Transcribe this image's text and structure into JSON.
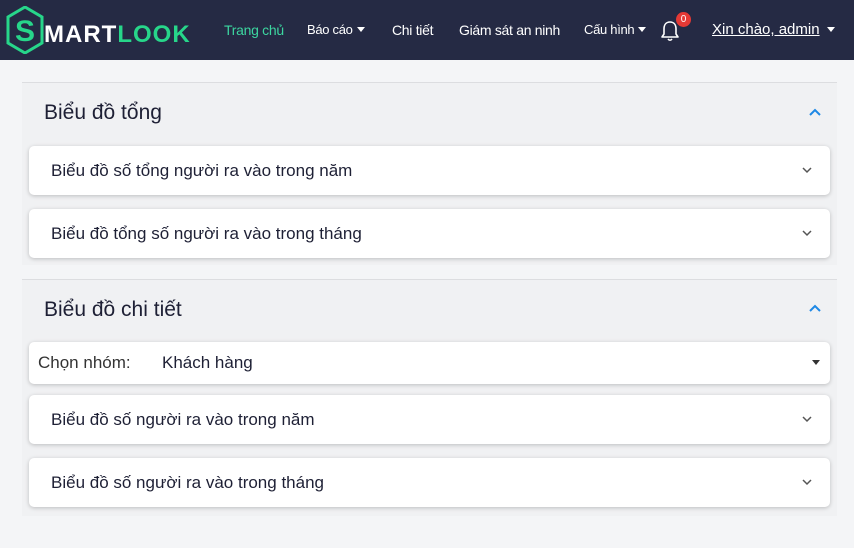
{
  "app": {
    "logo_s": "S",
    "logo_rest_1": "MART",
    "logo_rest_2": "LOOK"
  },
  "nav": {
    "home": "Trang chủ",
    "reports": "Báo cáo",
    "detail": "Chi tiết",
    "security": "Giám sát an ninh",
    "config": "Cấu hình",
    "notification_count": "0",
    "greeting": "Xin chào, admin"
  },
  "colors": {
    "navbar": "#252a44",
    "accent": "#3cd6a0",
    "badge": "#e53935"
  },
  "overview": {
    "title": "Biểu đồ tổng",
    "cards": [
      {
        "label": "Biểu đồ số tổng người ra vào trong năm"
      },
      {
        "label": "Biểu đồ tổng số người ra vào trong tháng"
      }
    ]
  },
  "detail_section": {
    "title": "Biểu đồ chi tiết",
    "group_select": {
      "label": "Chọn nhóm:",
      "value": "Khách hàng"
    },
    "cards": [
      {
        "label": "Biểu đồ số người ra vào trong năm"
      },
      {
        "label": "Biểu đồ số người ra vào trong tháng"
      }
    ]
  }
}
